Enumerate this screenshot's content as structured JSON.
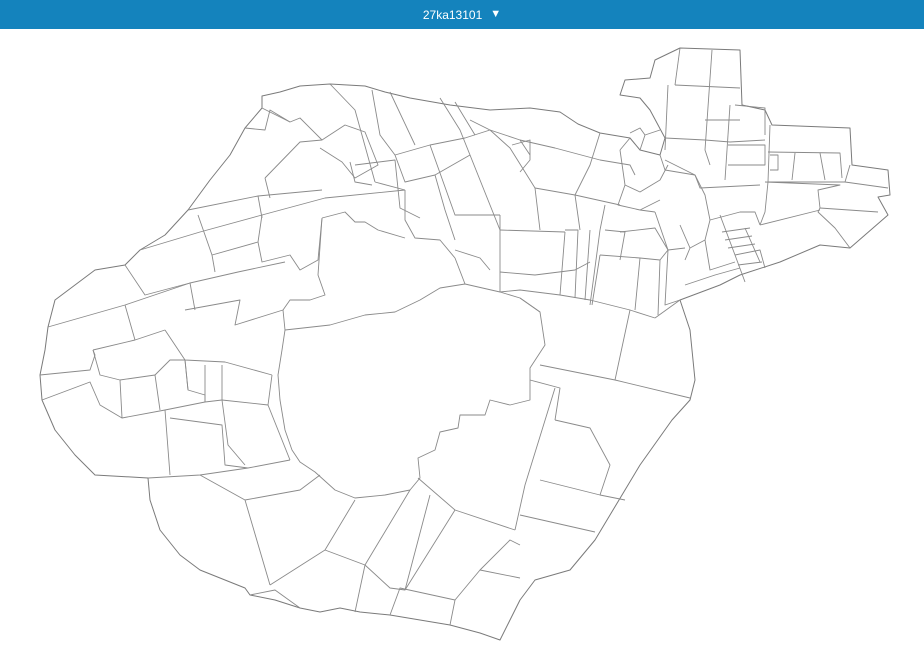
{
  "header": {
    "area_code": "27ka13101",
    "caret_icon": "triangle-down-icon",
    "color": "#1483bd"
  },
  "map": {
    "stroke_color": "#8a8a8a",
    "background": "#ffffff"
  }
}
